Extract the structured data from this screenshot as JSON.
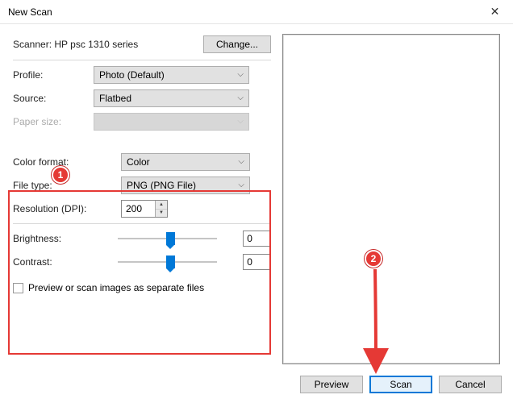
{
  "window": {
    "title": "New Scan"
  },
  "scanner": {
    "label": "Scanner: HP psc 1310 series",
    "change_btn": "Change..."
  },
  "profile": {
    "label": "Profile:",
    "value": "Photo (Default)"
  },
  "source": {
    "label": "Source:",
    "value": "Flatbed"
  },
  "papersize": {
    "label": "Paper size:",
    "value": ""
  },
  "colorformat": {
    "label": "Color format:",
    "value": "Color"
  },
  "filetype": {
    "label": "File type:",
    "value": "PNG (PNG File)"
  },
  "resolution": {
    "label": "Resolution (DPI):",
    "value": "200"
  },
  "brightness": {
    "label": "Brightness:",
    "value": "0"
  },
  "contrast": {
    "label": "Contrast:",
    "value": "0"
  },
  "checkbox": {
    "label": "Preview or scan images as separate files"
  },
  "footer": {
    "preview": "Preview",
    "scan": "Scan",
    "cancel": "Cancel"
  },
  "annotations": {
    "marker1": "1",
    "marker2": "2"
  }
}
